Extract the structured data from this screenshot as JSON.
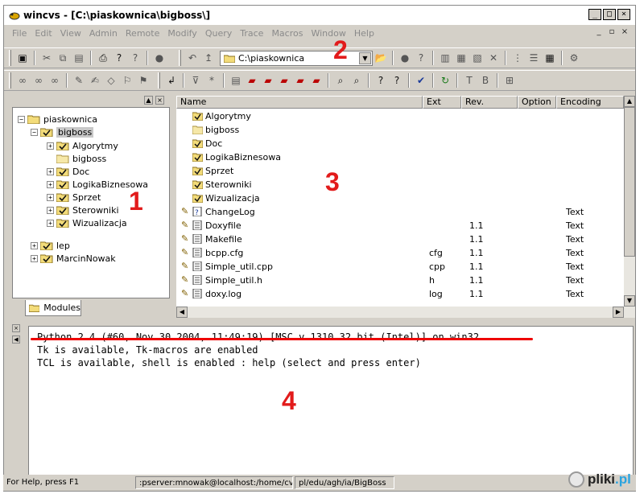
{
  "window": {
    "title": "wincvs - [C:\\piaskownica\\bigboss\\]"
  },
  "menu": [
    "File",
    "Edit",
    "View",
    "Admin",
    "Remote",
    "Modify",
    "Query",
    "Trace",
    "Macros",
    "Window",
    "Help"
  ],
  "toolbar": {
    "path_value": "C:\\piaskownica"
  },
  "tree": {
    "root": "piaskownica",
    "selected": "bigboss",
    "children": [
      "Algorytmy",
      "bigboss",
      "Doc",
      "LogikaBiznesowa",
      "Sprzet",
      "Sterowniki",
      "Wizualizacja"
    ],
    "siblings": [
      "lep",
      "MarcinNowak"
    ],
    "tab_label": "Modules"
  },
  "files": {
    "columns": [
      "Name",
      "Ext",
      "Rev.",
      "Option",
      "Encoding"
    ],
    "rows": [
      {
        "name": "Algorytmy",
        "ext": "",
        "rev": "",
        "enc": ""
      },
      {
        "name": "bigboss",
        "ext": "",
        "rev": "",
        "enc": ""
      },
      {
        "name": "Doc",
        "ext": "",
        "rev": "",
        "enc": ""
      },
      {
        "name": "LogikaBiznesowa",
        "ext": "",
        "rev": "",
        "enc": ""
      },
      {
        "name": "Sprzet",
        "ext": "",
        "rev": "",
        "enc": ""
      },
      {
        "name": "Sterowniki",
        "ext": "",
        "rev": "",
        "enc": ""
      },
      {
        "name": "Wizualizacja",
        "ext": "",
        "rev": "",
        "enc": ""
      },
      {
        "name": "ChangeLog",
        "ext": "",
        "rev": "",
        "enc": "Text"
      },
      {
        "name": "Doxyfile",
        "ext": "",
        "rev": "1.1",
        "enc": "Text"
      },
      {
        "name": "Makefile",
        "ext": "",
        "rev": "1.1",
        "enc": "Text"
      },
      {
        "name": "bcpp.cfg",
        "ext": "cfg",
        "rev": "1.1",
        "enc": "Text"
      },
      {
        "name": "Simple_util.cpp",
        "ext": "cpp",
        "rev": "1.1",
        "enc": "Text"
      },
      {
        "name": "Simple_util.h",
        "ext": "h",
        "rev": "1.1",
        "enc": "Text"
      },
      {
        "name": "doxy.log",
        "ext": "log",
        "rev": "1.1",
        "enc": "Text"
      }
    ]
  },
  "console": {
    "lines": [
      "Python 2.4 (#60, Nov 30 2004, 11:49:19) [MSC v.1310 32 bit (Intel)] on win32",
      "Tk is available, Tk-macros are enabled",
      "TCL is available, shell is enabled : help (select and press enter)"
    ]
  },
  "status": {
    "help": "For Help, press F1",
    "cvsroot": ":pserver:mnowak@localhost:/home/cvsr",
    "path": "pl/edu/agh/ia/BigBoss"
  },
  "annotations": [
    "1",
    "2",
    "3",
    "4"
  ],
  "watermark": {
    "part1": "pliki",
    "part2": ".pl"
  },
  "colors": {
    "annotation": "#e21b1b",
    "menu_disabled": "#8a8a8a"
  }
}
